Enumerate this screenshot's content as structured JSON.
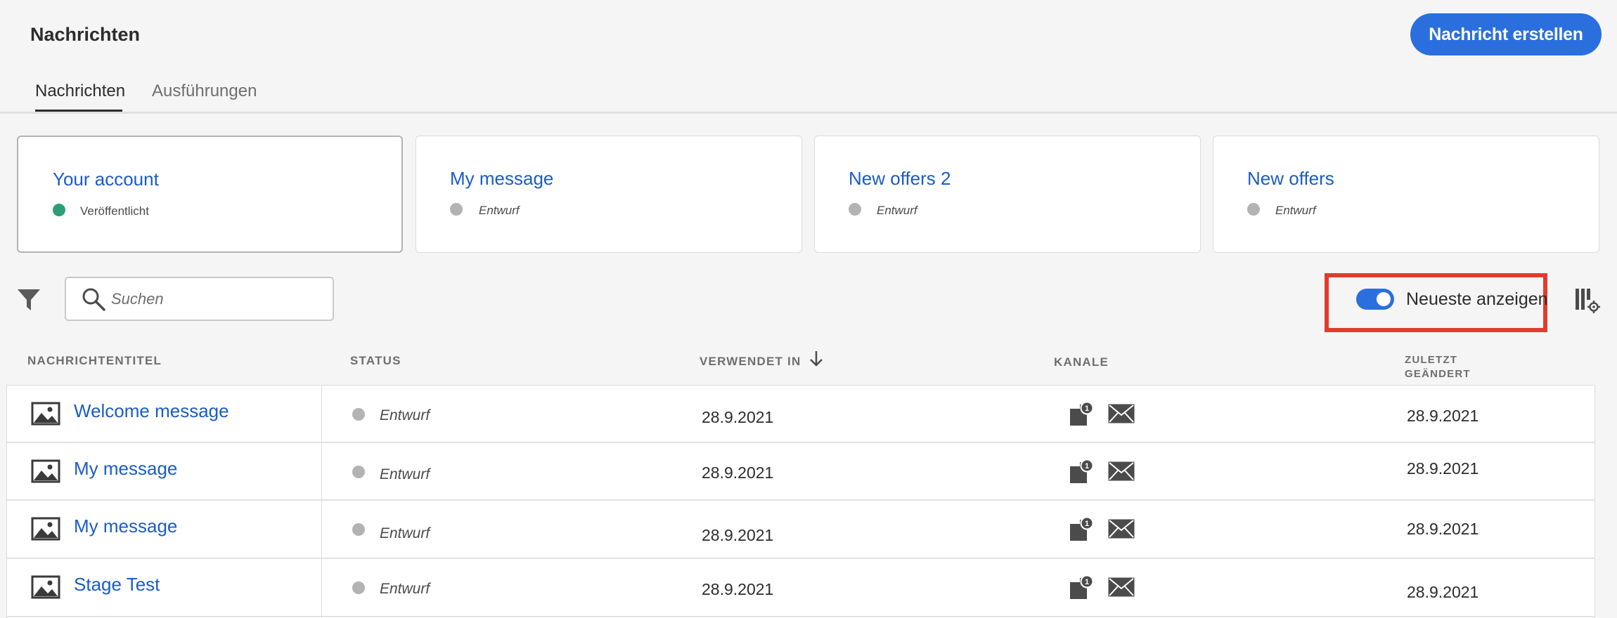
{
  "header": {
    "title": "Nachrichten",
    "create_button": "Nachricht erstellen",
    "tabs": [
      {
        "label": "Nachrichten",
        "active": true
      },
      {
        "label": "Ausführungen",
        "active": false
      }
    ]
  },
  "cards": [
    {
      "title": "Your account",
      "status": "Veröffentlicht",
      "status_color": "#2d9d78"
    },
    {
      "title": "My message",
      "status": "Entwurf",
      "status_color": "#b3b3b3"
    },
    {
      "title": "New offers 2",
      "status": "Entwurf",
      "status_color": "#b3b3b3"
    },
    {
      "title": "New offers",
      "status": "Entwurf",
      "status_color": "#b3b3b3"
    }
  ],
  "toolbar": {
    "filter_icon": "filter-icon",
    "search_placeholder": "Suchen",
    "toggle_label": "Neueste anzeigen",
    "toggle_on": true,
    "column_settings_icon": "column-settings-icon"
  },
  "table": {
    "columns": {
      "title": "NACHRICHTENTITEL",
      "status": "STATUS",
      "used_in": "VERWENDET IN",
      "channels": "KANALE",
      "modified_line1": "ZULETZT",
      "modified_line2": "GEÄNDERT"
    },
    "sort_icon": "arrow-down-icon",
    "rows": [
      {
        "title": "Welcome message",
        "status": "Entwurf",
        "used_in": "28.9.2021",
        "modified": "28.9.2021",
        "inapp_badge": "1"
      },
      {
        "title": "My message",
        "status": "Entwurf",
        "used_in": "28.9.2021",
        "modified": "28.9.2021",
        "inapp_badge": "1"
      },
      {
        "title": "My message",
        "status": "Entwurf",
        "used_in": "28.9.2021",
        "modified": "28.9.2021",
        "inapp_badge": "1"
      },
      {
        "title": "Stage Test",
        "status": "Entwurf",
        "used_in": "28.9.2021",
        "modified": "28.9.2021",
        "inapp_badge": "1"
      }
    ]
  },
  "colors": {
    "accent": "#2b6fde",
    "link": "#1a5cc8",
    "highlight": "#e23b2e",
    "published": "#2d9d78",
    "draft": "#b3b3b3"
  }
}
